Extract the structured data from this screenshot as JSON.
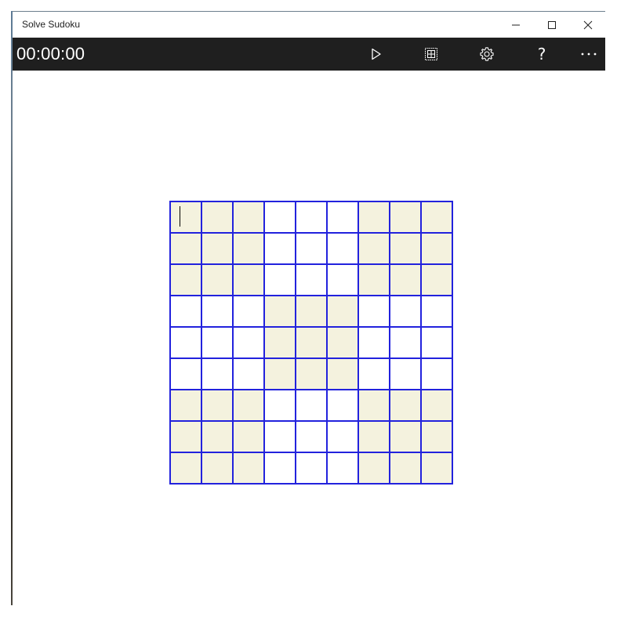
{
  "window": {
    "title": "Solve Sudoku"
  },
  "toolbar": {
    "timer": "00:00:00",
    "help_label": "?",
    "buttons": [
      {
        "name": "play-icon"
      },
      {
        "name": "grid-icon"
      },
      {
        "name": "gear-icon"
      },
      {
        "name": "help-icon"
      },
      {
        "name": "more-icon"
      }
    ]
  },
  "board": {
    "size": 9,
    "shaded_color": "#f4f2de",
    "line_color": "#2222dd",
    "shaded_boxes": [
      [
        0,
        0
      ],
      [
        0,
        2
      ],
      [
        1,
        1
      ],
      [
        2,
        0
      ],
      [
        2,
        2
      ]
    ],
    "values": [
      [
        "",
        "",
        "",
        "",
        "",
        "",
        "",
        "",
        ""
      ],
      [
        "",
        "",
        "",
        "",
        "",
        "",
        "",
        "",
        ""
      ],
      [
        "",
        "",
        "",
        "",
        "",
        "",
        "",
        "",
        ""
      ],
      [
        "",
        "",
        "",
        "",
        "",
        "",
        "",
        "",
        ""
      ],
      [
        "",
        "",
        "",
        "",
        "",
        "",
        "",
        "",
        ""
      ],
      [
        "",
        "",
        "",
        "",
        "",
        "",
        "",
        "",
        ""
      ],
      [
        "",
        "",
        "",
        "",
        "",
        "",
        "",
        "",
        ""
      ],
      [
        "",
        "",
        "",
        "",
        "",
        "",
        "",
        "",
        ""
      ],
      [
        "",
        "",
        "",
        "",
        "",
        "",
        "",
        "",
        ""
      ]
    ],
    "focused_cell": [
      0,
      0
    ]
  }
}
